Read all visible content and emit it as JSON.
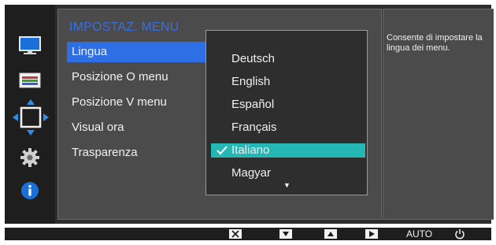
{
  "menu": {
    "title": "IMPOSTAZ. MENU",
    "items": [
      {
        "label": "Lingua",
        "selected": true
      },
      {
        "label": "Posizione O menu",
        "selected": false
      },
      {
        "label": "Posizione V menu",
        "selected": false
      },
      {
        "label": "Visual ora",
        "selected": false
      },
      {
        "label": "Trasparenza",
        "selected": false
      }
    ]
  },
  "language_dropdown": {
    "options": [
      {
        "label": "Deutsch",
        "selected": false
      },
      {
        "label": "English",
        "selected": false
      },
      {
        "label": "Español",
        "selected": false
      },
      {
        "label": "Français",
        "selected": false
      },
      {
        "label": "Italiano",
        "selected": true
      },
      {
        "label": "Magyar",
        "selected": false
      }
    ],
    "more_indicator": "▼"
  },
  "help": {
    "text": "Consente di impostare la lingua dei menu."
  },
  "sidebar": {
    "icons": [
      "picture-icon",
      "color-icon",
      "onscreen-display-icon",
      "setup-icon",
      "information-icon"
    ]
  },
  "bottom_bar": {
    "buttons": [
      "close-icon",
      "down-arrow-icon",
      "up-arrow-icon",
      "enter-icon"
    ],
    "auto_label": "AUTO",
    "power_icon": "power-icon"
  },
  "colors": {
    "menu_title": "#3a6fe0",
    "menu_selected": "#2f6fe6",
    "option_selected": "#25b6b6",
    "panel_bg": "#4b4b4b",
    "osd_bg": "#2d2d2d"
  }
}
